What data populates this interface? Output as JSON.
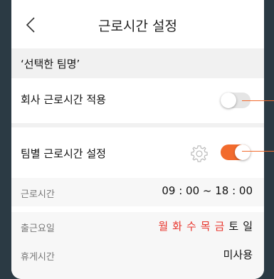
{
  "header": {
    "title": "근로시간 설정",
    "back_icon": "chevron-left-icon"
  },
  "team_name": "‘선택한 팀명’",
  "company_hours": {
    "label": "회사 근로시간 적용",
    "enabled": false
  },
  "team_hours": {
    "label": "팀별 근로시간 설정",
    "enabled": true,
    "settings_icon": "gear-icon"
  },
  "details": {
    "work_hours": {
      "label": "근로시간",
      "value": "09 : 00 ~ 18 : 00"
    },
    "work_days": {
      "label": "출근요일",
      "days": [
        {
          "label": "월",
          "active": true
        },
        {
          "label": "화",
          "active": true
        },
        {
          "label": "수",
          "active": true
        },
        {
          "label": "목",
          "active": true
        },
        {
          "label": "금",
          "active": true
        },
        {
          "label": "토",
          "active": false
        },
        {
          "label": "일",
          "active": false
        }
      ]
    },
    "break_time": {
      "label": "휴게시간",
      "value": "미사용"
    }
  },
  "colors": {
    "accent": "#f26b2d",
    "active_day": "#e8352c",
    "background": "#2b3a44"
  }
}
